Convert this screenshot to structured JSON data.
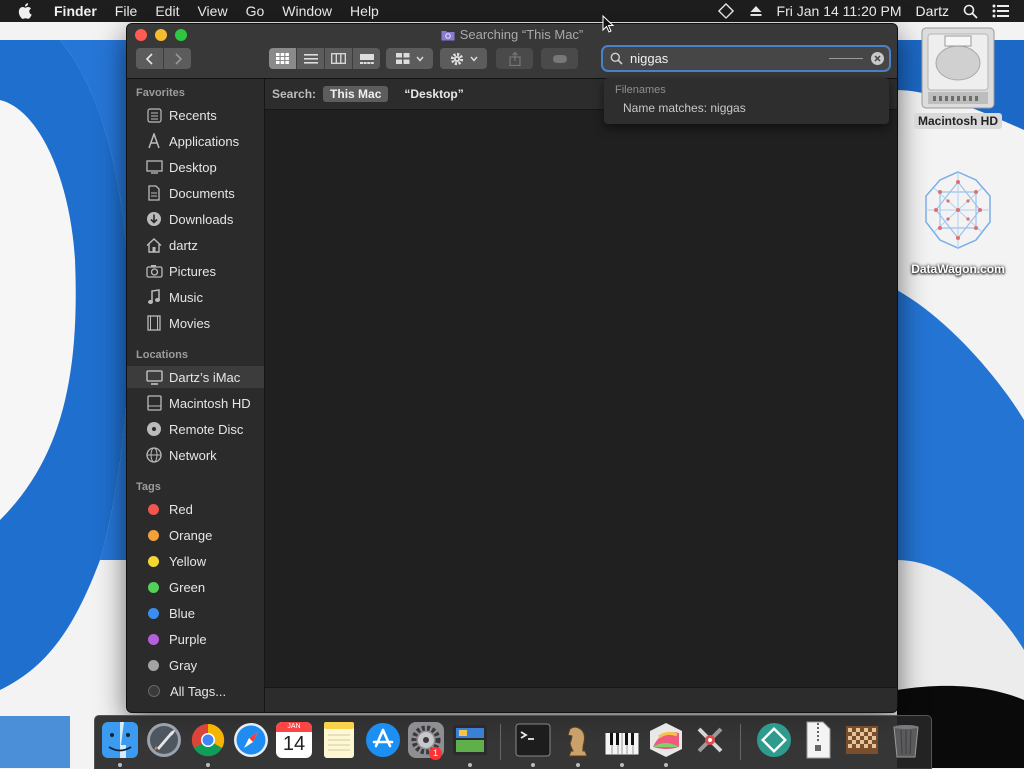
{
  "menubar": {
    "app_name": "Finder",
    "items": [
      "File",
      "Edit",
      "View",
      "Go",
      "Window",
      "Help"
    ],
    "clock": "Fri Jan 14  11:20 PM",
    "user": "Dartz"
  },
  "window": {
    "title": "Searching “This Mac”",
    "search_value": "niggas"
  },
  "suggestions": {
    "header": "Filenames",
    "item": "Name matches: niggas"
  },
  "scope": {
    "label": "Search:",
    "option_selected": "This Mac",
    "option_other": "“Desktop”"
  },
  "sidebar": {
    "favorites_header": "Favorites",
    "favorites": [
      "Recents",
      "Applications",
      "Desktop",
      "Documents",
      "Downloads",
      "dartz",
      "Pictures",
      "Music",
      "Movies"
    ],
    "locations_header": "Locations",
    "locations": [
      "Dartz’s iMac",
      "Macintosh HD",
      "Remote Disc",
      "Network"
    ],
    "tags_header": "Tags",
    "tags": [
      {
        "label": "Red",
        "color": "#f3544e"
      },
      {
        "label": "Orange",
        "color": "#f5a037"
      },
      {
        "label": "Yellow",
        "color": "#f4d630"
      },
      {
        "label": "Green",
        "color": "#50d357"
      },
      {
        "label": "Blue",
        "color": "#3a8ef2"
      },
      {
        "label": "Purple",
        "color": "#b55fdb"
      },
      {
        "label": "Gray",
        "color": "#a4a4a4"
      }
    ],
    "all_tags": "All Tags..."
  },
  "desktop": {
    "hd_label": "Macintosh HD",
    "datawagon_label": "DataWagon.com"
  },
  "dock": {
    "calendar_month": "JAN",
    "calendar_day": "14",
    "appstore_badge": "1"
  }
}
